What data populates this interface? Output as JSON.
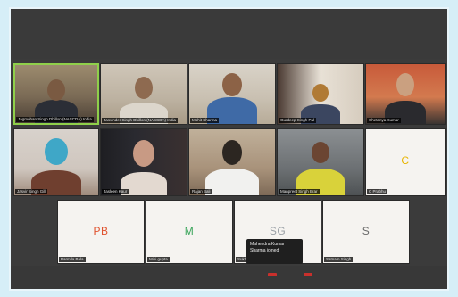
{
  "meeting": {
    "tiles_row1": [
      {
        "name": "Jagmohan Singh Dhillon (NASCDA) India",
        "initials": "",
        "active": true
      },
      {
        "name": "Jasvinder Singh Dhillon (NASCDA) India",
        "initials": "",
        "active": false
      },
      {
        "name": "Mohit Sharma",
        "initials": "",
        "active": false
      },
      {
        "name": "Gurdeep Singh Pal",
        "initials": "",
        "active": false
      },
      {
        "name": "Chetanya Kumar",
        "initials": "",
        "active": false
      }
    ],
    "tiles_row2": [
      {
        "name": "Jasvir Singh Gill",
        "initials": "",
        "active": false
      },
      {
        "name": "Jasleen Kaur",
        "initials": "",
        "active": false
      },
      {
        "name": "Rajan Bali",
        "initials": "",
        "active": false
      },
      {
        "name": "Manpreet Singh Brar",
        "initials": "",
        "active": false
      },
      {
        "name": "C Prabhu",
        "initials": "C",
        "active": false
      }
    ],
    "tiles_row3": [
      {
        "name": "Parmila Bala",
        "initials": "PB"
      },
      {
        "name": "Mini gupta",
        "initials": "M"
      },
      {
        "name": "Sukhdev Gurvinder",
        "initials": "SG"
      },
      {
        "name": "Satnam Singh",
        "initials": "S"
      }
    ],
    "tooltip": "Mahendra Kumar Sharma joined",
    "colors": {
      "active_speaker": "#8fd04a",
      "initials_PB": "#e0522e",
      "initials_M": "#3aa55b",
      "initials_SG": "#9aa0a6",
      "initials_S": "#6b6b6b",
      "initials_C": "#e8b400"
    }
  }
}
